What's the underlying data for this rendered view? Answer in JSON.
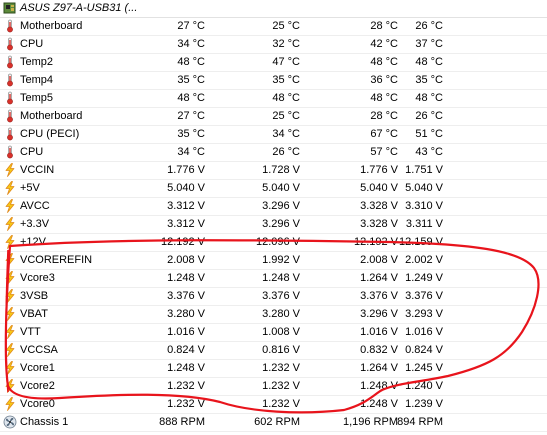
{
  "header": {
    "title": "ASUS Z97-A-USB31 (...",
    "icon": "motherboard-chip-icon"
  },
  "rows": [
    {
      "icon": "thermometer-icon",
      "label": "Motherboard",
      "v1": "27 °C",
      "v2": "25 °C",
      "v3": "28 °C",
      "v4": "26 °C"
    },
    {
      "icon": "thermometer-icon",
      "label": "CPU",
      "v1": "34 °C",
      "v2": "32 °C",
      "v3": "42 °C",
      "v4": "37 °C"
    },
    {
      "icon": "thermometer-icon",
      "label": "Temp2",
      "v1": "48 °C",
      "v2": "47 °C",
      "v3": "48 °C",
      "v4": "48 °C"
    },
    {
      "icon": "thermometer-icon",
      "label": "Temp4",
      "v1": "35 °C",
      "v2": "35 °C",
      "v3": "36 °C",
      "v4": "35 °C"
    },
    {
      "icon": "thermometer-icon",
      "label": "Temp5",
      "v1": "48 °C",
      "v2": "48 °C",
      "v3": "48 °C",
      "v4": "48 °C"
    },
    {
      "icon": "thermometer-icon",
      "label": "Motherboard",
      "v1": "27 °C",
      "v2": "25 °C",
      "v3": "28 °C",
      "v4": "26 °C"
    },
    {
      "icon": "thermometer-icon",
      "label": "CPU (PECI)",
      "v1": "35 °C",
      "v2": "34 °C",
      "v3": "67 °C",
      "v4": "51 °C"
    },
    {
      "icon": "thermometer-icon",
      "label": "CPU",
      "v1": "34 °C",
      "v2": "26 °C",
      "v3": "57 °C",
      "v4": "43 °C"
    },
    {
      "icon": "voltage-bolt-icon",
      "label": "VCCIN",
      "v1": "1.776 V",
      "v2": "1.728 V",
      "v3": "1.776 V",
      "v4": "1.751 V"
    },
    {
      "icon": "voltage-bolt-icon",
      "label": "+5V",
      "v1": "5.040 V",
      "v2": "5.040 V",
      "v3": "5.040 V",
      "v4": "5.040 V"
    },
    {
      "icon": "voltage-bolt-icon",
      "label": "AVCC",
      "v1": "3.312 V",
      "v2": "3.296 V",
      "v3": "3.328 V",
      "v4": "3.310 V"
    },
    {
      "icon": "voltage-bolt-icon",
      "label": "+3.3V",
      "v1": "3.312 V",
      "v2": "3.296 V",
      "v3": "3.328 V",
      "v4": "3.311 V"
    },
    {
      "icon": "voltage-bolt-icon",
      "label": "+12V",
      "v1": "12.192 V",
      "v2": "12.096 V",
      "v3": "12.192 V",
      "v4": "12.159 V"
    },
    {
      "icon": "voltage-bolt-icon",
      "label": "VCOREREFIN",
      "v1": "2.008 V",
      "v2": "1.992 V",
      "v3": "2.008 V",
      "v4": "2.002 V"
    },
    {
      "icon": "voltage-bolt-icon",
      "label": "Vcore3",
      "v1": "1.248 V",
      "v2": "1.248 V",
      "v3": "1.264 V",
      "v4": "1.249 V"
    },
    {
      "icon": "voltage-bolt-icon",
      "label": "3VSB",
      "v1": "3.376 V",
      "v2": "3.376 V",
      "v3": "3.376 V",
      "v4": "3.376 V"
    },
    {
      "icon": "voltage-bolt-icon",
      "label": "VBAT",
      "v1": "3.280 V",
      "v2": "3.280 V",
      "v3": "3.296 V",
      "v4": "3.293 V"
    },
    {
      "icon": "voltage-bolt-icon",
      "label": "VTT",
      "v1": "1.016 V",
      "v2": "1.008 V",
      "v3": "1.016 V",
      "v4": "1.016 V"
    },
    {
      "icon": "voltage-bolt-icon",
      "label": "VCCSA",
      "v1": "0.824 V",
      "v2": "0.816 V",
      "v3": "0.832 V",
      "v4": "0.824 V"
    },
    {
      "icon": "voltage-bolt-icon",
      "label": "Vcore1",
      "v1": "1.248 V",
      "v2": "1.232 V",
      "v3": "1.264 V",
      "v4": "1.245 V"
    },
    {
      "icon": "voltage-bolt-icon",
      "label": "Vcore2",
      "v1": "1.232 V",
      "v2": "1.232 V",
      "v3": "1.248 V",
      "v4": "1.240 V"
    },
    {
      "icon": "voltage-bolt-icon",
      "label": "Vcore0",
      "v1": "1.232 V",
      "v2": "1.232 V",
      "v3": "1.248 V",
      "v4": "1.239 V"
    },
    {
      "icon": "fan-icon",
      "label": "Chassis 1",
      "v1": "888 RPM",
      "v2": "602 RPM",
      "v3": "1,196 RPM",
      "v4": "894 RPM"
    }
  ],
  "colors": {
    "annotation": "#e8141c",
    "thermo_red": "#d9302a",
    "bolt_yellow": "#f7c815",
    "bolt_orange": "#e0891a"
  }
}
